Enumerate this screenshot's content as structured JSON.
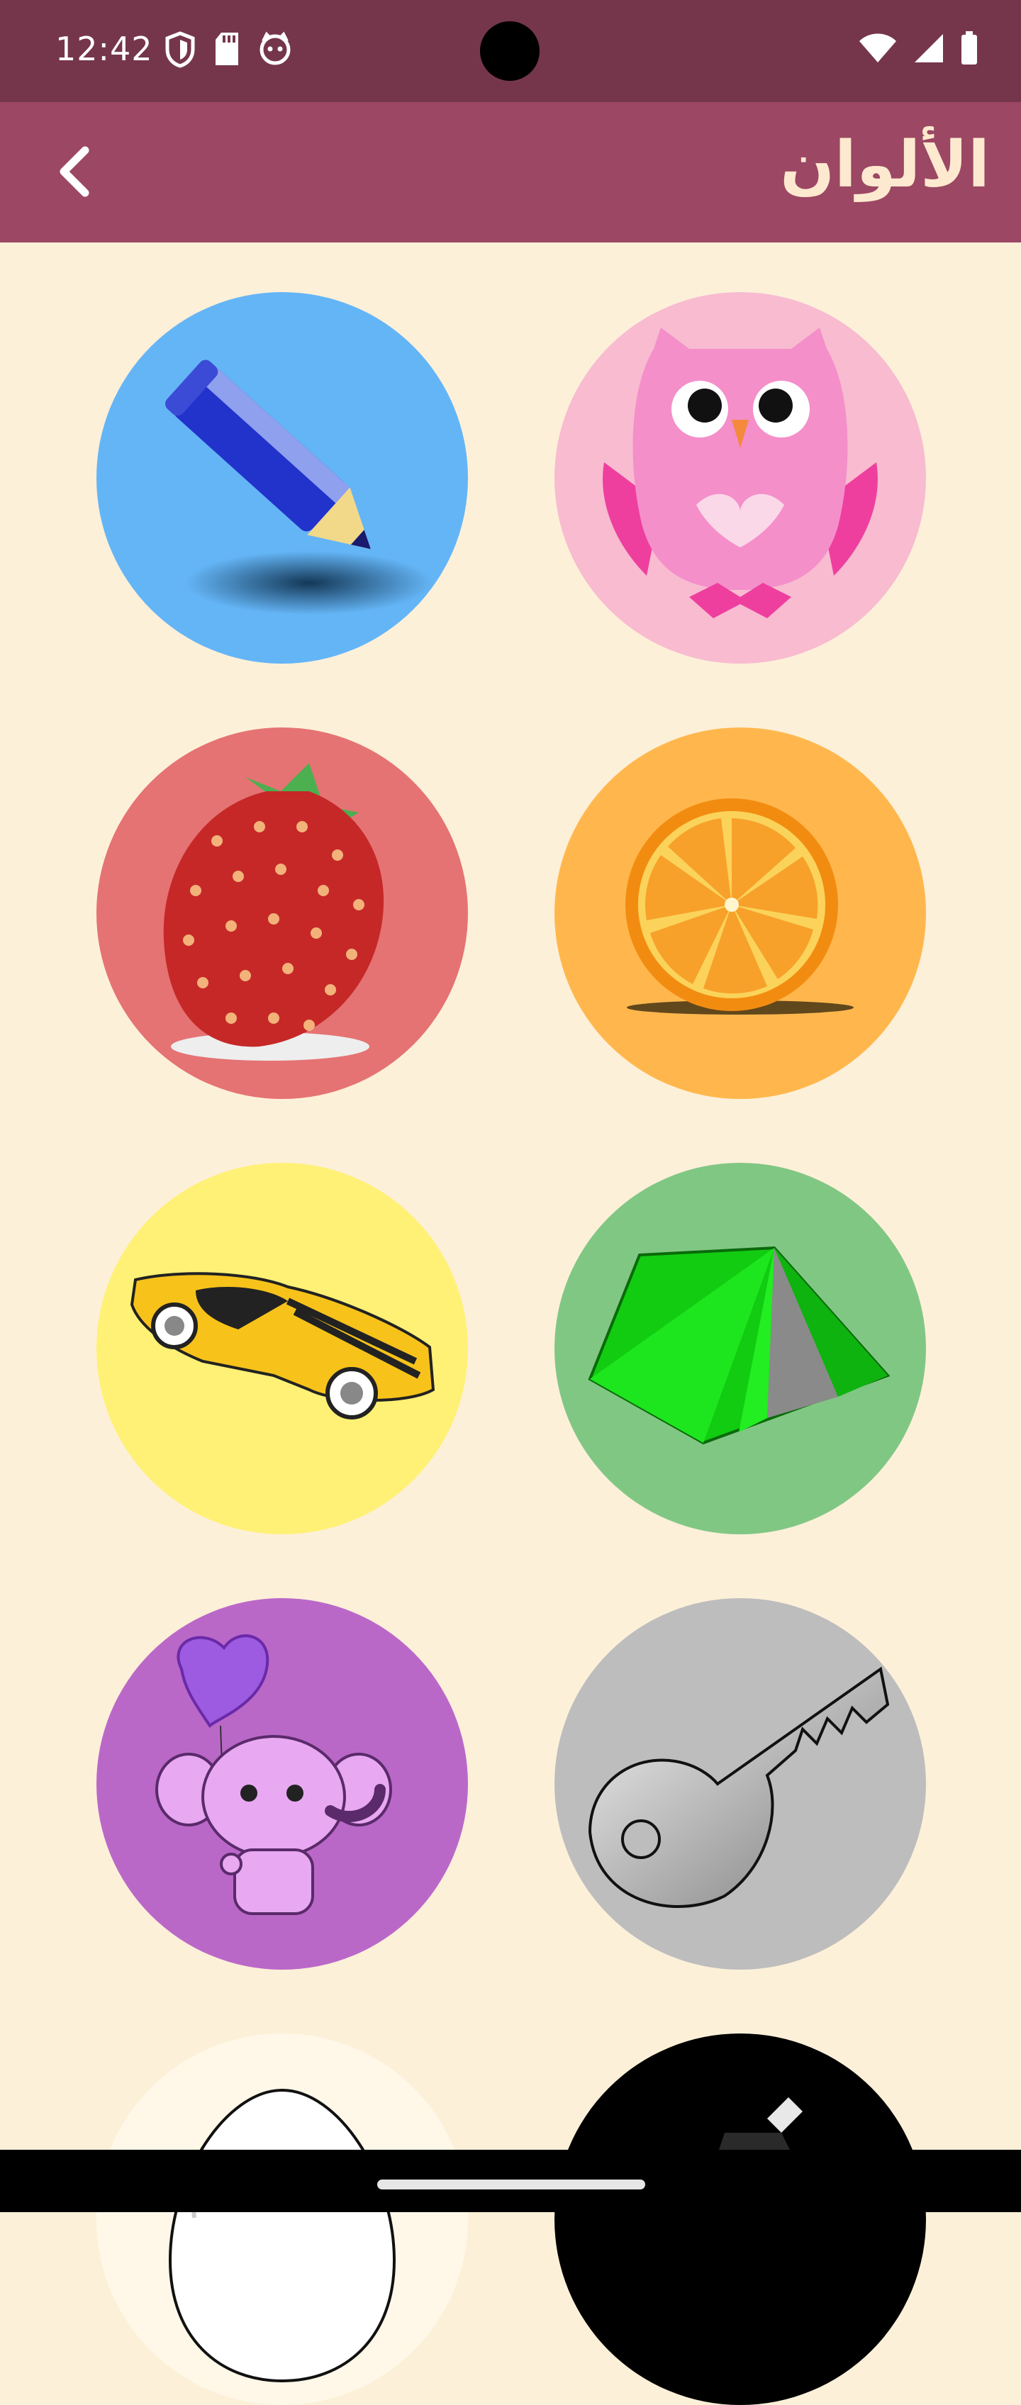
{
  "status_bar": {
    "time": "12:42",
    "icons_left": [
      "shield-icon",
      "sd-card-icon",
      "face-icon"
    ],
    "icons_right": [
      "wifi-icon",
      "signal-icon",
      "battery-icon"
    ]
  },
  "app_bar": {
    "title": "الألوان",
    "back_icon": "chevron-left-icon"
  },
  "colors": {
    "status_bar": "#75364c",
    "app_bar": "#9c4764",
    "title_text": "#fde9cf",
    "background": "#fdf0d9"
  },
  "items": [
    {
      "name": "blue-pencil",
      "bg": "#64b5f6"
    },
    {
      "name": "pink-owl",
      "bg": "#f8bbd0"
    },
    {
      "name": "red-strawberry",
      "bg": "#e57373"
    },
    {
      "name": "orange-slice",
      "bg": "#ffb74d"
    },
    {
      "name": "yellow-car",
      "bg": "#fff176"
    },
    {
      "name": "green-tent",
      "bg": "#81c784"
    },
    {
      "name": "purple-elephant",
      "bg": "#ba68c8"
    },
    {
      "name": "grey-key",
      "bg": "#bdbdbd"
    },
    {
      "name": "white-egg",
      "bg": "#fff8e8"
    },
    {
      "name": "black-hat",
      "bg": "#000000"
    }
  ]
}
